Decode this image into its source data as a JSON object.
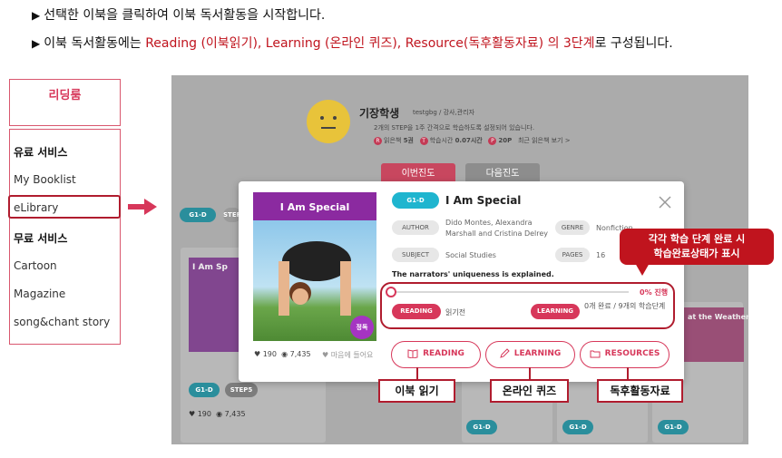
{
  "instructions": {
    "line1": "선택한 이북을 클릭하여 이북 독서활동을 시작합니다.",
    "line2_prefix": "이북 독서활동에는 ",
    "line2_red": "Reading (이북읽기), Learning (온라인 퀴즈), Resource(독후활동자료) 의 3단계",
    "line2_suffix": "로 구성됩니다."
  },
  "sidebar": {
    "header": "리딩룸",
    "paid_section": "유료 서비스",
    "paid_items": [
      "My Booklist",
      "eLibrary"
    ],
    "free_section": "무료 서비스",
    "free_items": [
      "Cartoon",
      "Magazine",
      "song&chant story"
    ]
  },
  "profile": {
    "name": "기장학생",
    "id": "testgbg / 강사,관리자",
    "setting": "2개의 STEP을 1주 간격으로 학습하도록 설정되어 있습니다.",
    "read_label": "읽은책",
    "read_value": "5권",
    "time_label": "학습시간",
    "time_value": "0.07시간",
    "points": "20P",
    "recent": "최근 읽은책 보기 >",
    "tab_current": "이번진도",
    "tab_next": "다음진도"
  },
  "background": {
    "level": "G1-D",
    "step": "STEP5",
    "likes": "190",
    "views": "7,435",
    "card_title_left": "I Am Sp",
    "card_title_right": "at the Weather"
  },
  "modal": {
    "level": "G1-D",
    "title": "I Am Special",
    "cover_title": "I Am Special",
    "badge": "정독",
    "author_label": "AUTHOR",
    "author_value": "Dido Montes, Alexandra Marshall and Cristina Delrey",
    "genre_label": "GENRE",
    "genre_value": "Nonfiction",
    "subject_label": "SUBJECT",
    "subject_value": "Social Studies",
    "pages_label": "PAGES",
    "pages_value": "16",
    "description": "The narrators' uniqueness is explained.",
    "progress": 0,
    "progress_text": "0% 진행",
    "reading_label": "READING",
    "reading_status": "읽기전",
    "learning_label": "LEARNING",
    "learning_status": "0개 완료 / 9개의 학습단계",
    "likes": "190",
    "views": "7,435",
    "fav": "마음에 들어요",
    "btn_reading": "READING",
    "btn_learning": "LEARNING",
    "btn_resources": "RESOURCES"
  },
  "annotations": {
    "bubble_line1": "각각 학습 단계 완료 시",
    "bubble_line2": "학습완료상태가 표시",
    "callout_reading": "이북 읽기",
    "callout_learning": "온라인 퀴즈",
    "callout_resources": "독후활동자료"
  },
  "colors": {
    "accent": "#d7375a",
    "annotation_red": "#b01c2e",
    "teal": "#1fb5cf",
    "cover_purple": "#8b2aa0"
  }
}
